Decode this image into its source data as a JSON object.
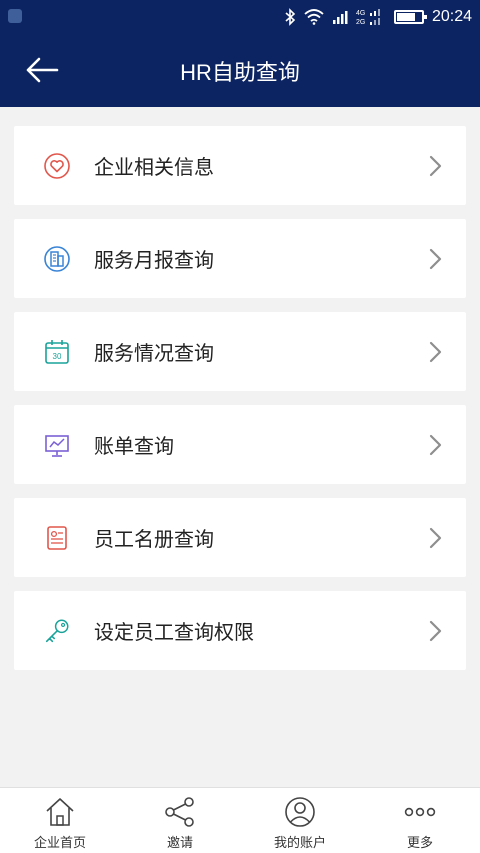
{
  "status_bar": {
    "time": "20:24",
    "network": "4G 2G"
  },
  "app_bar": {
    "title": "HR自助查询"
  },
  "menu": [
    {
      "label": "企业相关信息",
      "icon": "heart-circle-icon",
      "color": "#e2574c"
    },
    {
      "label": "服务月报查询",
      "icon": "building-report-icon",
      "color": "#3a84d6"
    },
    {
      "label": "服务情况查询",
      "icon": "calendar-icon",
      "color": "#1aa39a"
    },
    {
      "label": "账单查询",
      "icon": "chart-board-icon",
      "color": "#7b61d6"
    },
    {
      "label": "员工名册查询",
      "icon": "id-card-icon",
      "color": "#e2574c"
    },
    {
      "label": "设定员工查询权限",
      "icon": "key-icon",
      "color": "#1aa39a"
    }
  ],
  "bottom_nav": [
    {
      "label": "企业首页",
      "icon": "home-icon"
    },
    {
      "label": "邀请",
      "icon": "share-icon"
    },
    {
      "label": "我的账户",
      "icon": "user-circle-icon"
    },
    {
      "label": "更多",
      "icon": "more-dots-icon"
    }
  ]
}
